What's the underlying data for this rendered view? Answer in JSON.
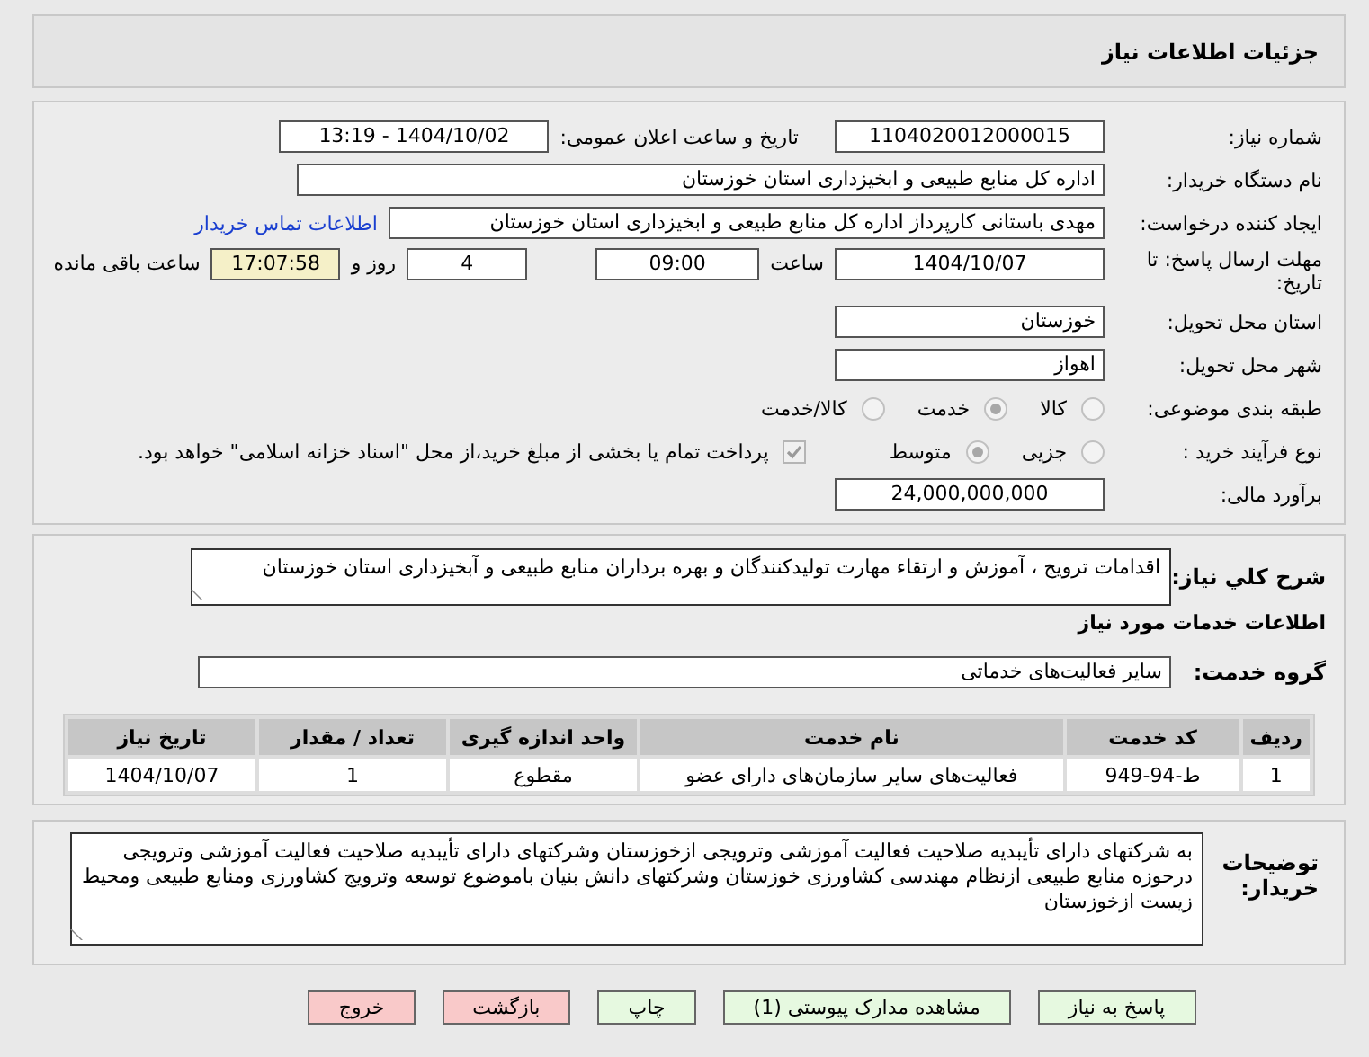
{
  "header": {
    "title": "جزئیات اطلاعات نیاز"
  },
  "need_number": {
    "label": "شماره نیاز:",
    "value": "1104020012000015"
  },
  "announce": {
    "label": "تاریخ و ساعت اعلان عمومی:",
    "value": "1404/10/02 - 13:19"
  },
  "buyer_org": {
    "label": "نام دستگاه خریدار:",
    "value": "اداره کل منابع طبیعی و ابخیزداری استان خوزستان"
  },
  "creator": {
    "label": "ایجاد کننده درخواست:",
    "value": "مهدی باستانی کارپرداز اداره کل منابع طبیعی و ابخیزداری استان خوزستان",
    "link": "اطلاعات تماس خریدار"
  },
  "deadline": {
    "label": "مهلت ارسال پاسخ: تا تاریخ:",
    "date": "1404/10/07",
    "time_label": "ساعت",
    "time": "09:00",
    "days": "4",
    "days_label": "روز و",
    "remaining": "17:07:58",
    "remaining_label": "ساعت باقی مانده"
  },
  "province": {
    "label": "استان محل تحویل:",
    "value": "خوزستان"
  },
  "city": {
    "label": "شهر محل تحویل:",
    "value": "اهواز"
  },
  "category": {
    "label": "طبقه بندی موضوعی:",
    "options": [
      {
        "label": "كالا",
        "selected": false
      },
      {
        "label": "خدمت",
        "selected": true
      },
      {
        "label": "كالا/خدمت",
        "selected": false
      }
    ]
  },
  "process": {
    "label": "نوع فرآیند خرید :",
    "options": [
      {
        "label": "جزیی",
        "selected": false
      },
      {
        "label": "متوسط",
        "selected": true
      }
    ],
    "payment": {
      "label": "پرداخت تمام یا بخشی از مبلغ خرید،از محل \"اسناد خزانه اسلامی\" خواهد بود.",
      "checked": true
    }
  },
  "budget": {
    "label": "برآورد مالی:",
    "value": "24,000,000,000"
  },
  "summary": {
    "label": "شرح كلي نیاز:",
    "value": "اقدامات ترویج ، آموزش و ارتقاء مهارت تولیدکنندگان و بهره برداران  منابع طبیعی و آبخیزداری  استان خوزستان"
  },
  "services_title": "اطلاعات خدمات مورد نیاز",
  "service_group": {
    "label": "گروه خدمت:",
    "value": "سایر فعالیت‌های خدماتی"
  },
  "table": {
    "columns": [
      "ردیف",
      "کد خدمت",
      "نام خدمت",
      "واحد اندازه گیری",
      "تعداد / مقدار",
      "تاریخ نیاز"
    ],
    "rows": [
      [
        "1",
        "ط-94-949",
        "فعالیت‌های سایر سازمان‌های دارای عضو",
        "مقطوع",
        "1",
        "1404/10/07"
      ]
    ]
  },
  "notes": {
    "label": "توضیحات خریدار:",
    "value": "به شرکتهای دارای تأیبدیه صلاحیت فعالیت آموزشی وترویجی ازخوزستان وشرکتهای دارای تأیبدیه صلاحیت فعالیت آموزشی وترویجی درحوزه منابع طبیعی ازنظام مهندسی کشاورزی خوزستان وشرکتهای دانش بنیان باموضوع توسعه وترویج کشاورزی ومنابع طبیعی ومحیط زیست ازخوزستان"
  },
  "buttons": [
    {
      "label": "پاسخ به نیاز",
      "kind": "green"
    },
    {
      "label": "مشاهده مدارک پیوستی (1)",
      "kind": "green"
    },
    {
      "label": "چاپ",
      "kind": "green"
    },
    {
      "label": "بازگشت",
      "kind": "red"
    },
    {
      "label": "خروج",
      "kind": "red"
    }
  ]
}
